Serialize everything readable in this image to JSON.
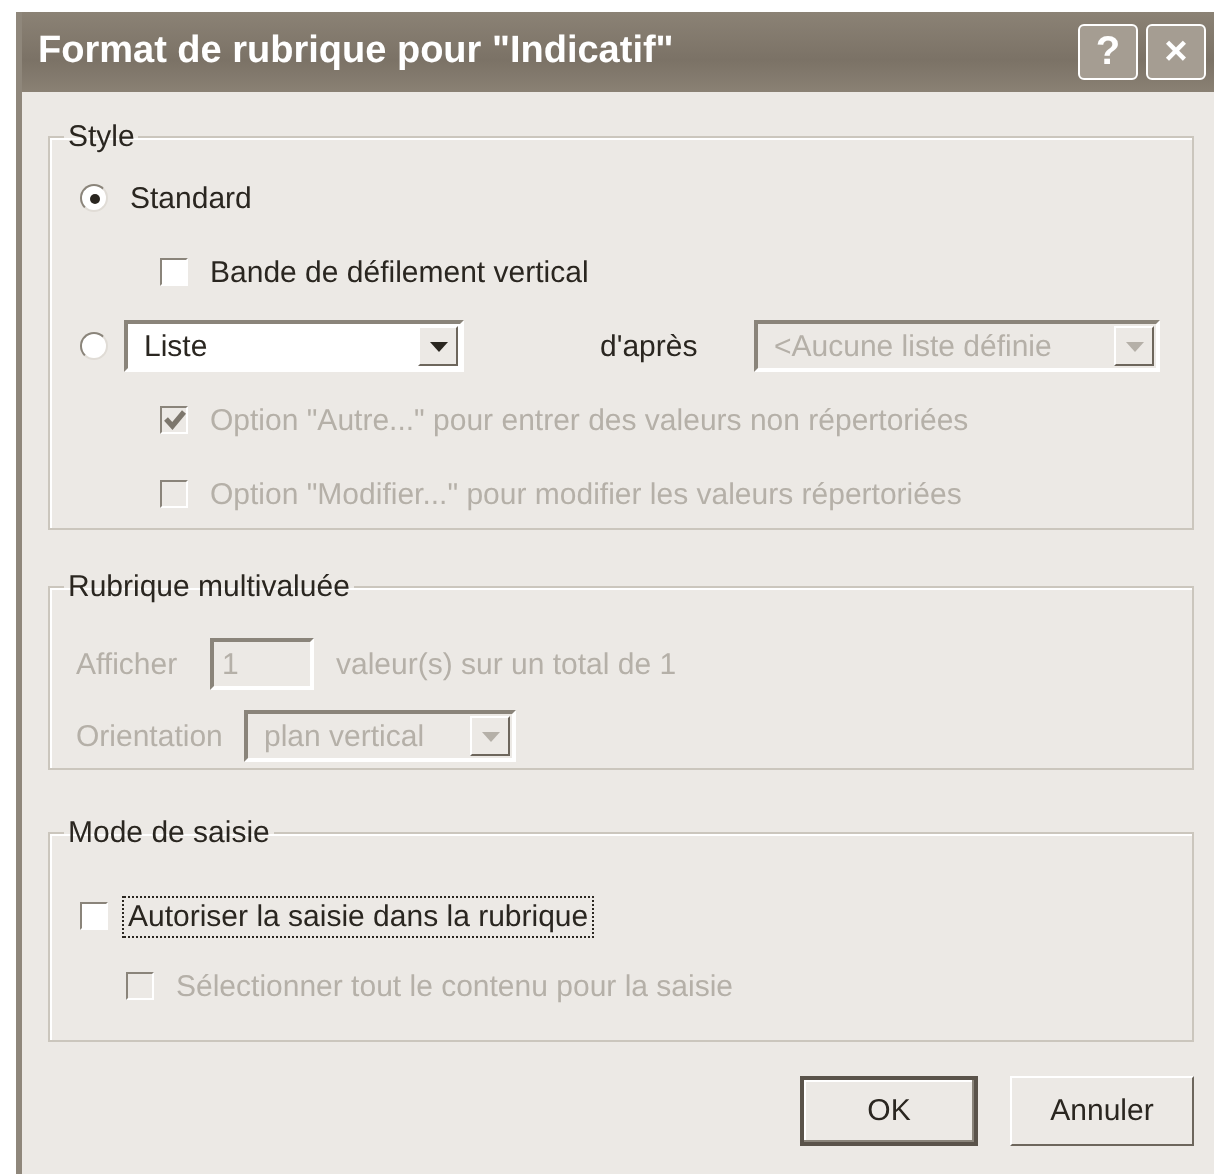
{
  "window": {
    "title": "Format de rubrique pour \"Indicatif\"",
    "help_button": "?",
    "close_button": "×"
  },
  "style_group": {
    "label": "Style",
    "choices": [
      {
        "kind": "label",
        "label": "Standard",
        "selected": true
      },
      {
        "kind": "dropdown",
        "selected": false
      }
    ],
    "scrollbar_checkbox": {
      "label": "Bande de défilement vertical",
      "checked": false
    },
    "list_type": {
      "value": "Liste",
      "disabled": false
    },
    "source_label": "d'après",
    "source_list": {
      "value": "<Aucune liste définie",
      "disabled": true
    },
    "options": [
      {
        "label": "Option \"Autre...\" pour entrer des valeurs non répertoriées",
        "checked": true,
        "disabled": true
      },
      {
        "label": "Option \"Modifier...\" pour modifier les valeurs répertoriées",
        "checked": false,
        "disabled": true
      }
    ]
  },
  "multivalue_group": {
    "label": "Rubrique multivaluée",
    "disabled": true,
    "show_label": "Afficher",
    "show_count": "1",
    "total_text": "valeur(s) sur un total de 1",
    "orientation_label": "Orientation",
    "orientation": "plan vertical"
  },
  "entry_group": {
    "label": "Mode de saisie",
    "options": [
      {
        "label": "Autoriser la saisie dans la rubrique",
        "checked": false,
        "disabled": false,
        "focused": true
      },
      {
        "label": "Sélectionner tout le contenu pour la saisie",
        "checked": false,
        "disabled": true,
        "focused": false
      }
    ]
  },
  "buttons": [
    {
      "label": "OK",
      "default": true
    },
    {
      "label": "Annuler",
      "default": false
    }
  ]
}
